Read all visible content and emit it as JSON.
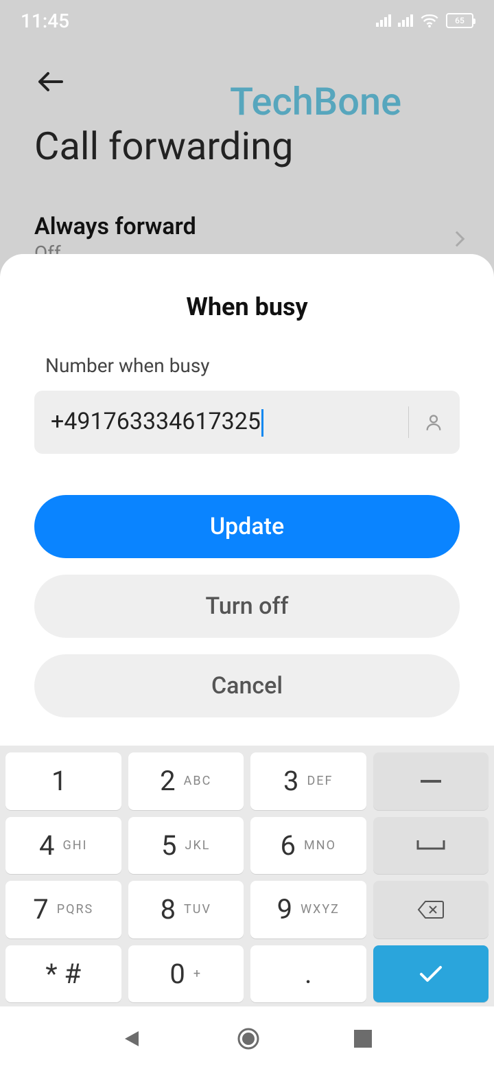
{
  "status": {
    "time": "11:45",
    "battery": "65"
  },
  "watermark": "TechBone",
  "page": {
    "title": "Call forwarding",
    "list": {
      "always_forward_label": "Always forward",
      "always_forward_status": "Off"
    }
  },
  "dialog": {
    "title": "When busy",
    "field_label": "Number when busy",
    "field_value": "+491763334617325",
    "update_label": "Update",
    "turnoff_label": "Turn off",
    "cancel_label": "Cancel"
  },
  "keypad": {
    "k1": "1",
    "k1s": "",
    "k2": "2",
    "k2s": "ABC",
    "k3": "3",
    "k3s": "DEF",
    "k4": "4",
    "k4s": "GHI",
    "k5": "5",
    "k5s": "JKL",
    "k6": "6",
    "k6s": "MNO",
    "k7": "7",
    "k7s": "PQRS",
    "k8": "8",
    "k8s": "TUV",
    "k9": "9",
    "k9s": "WXYZ",
    "k0": "0",
    "k0s": "+",
    "kstar": "* #",
    "kdot": "."
  }
}
